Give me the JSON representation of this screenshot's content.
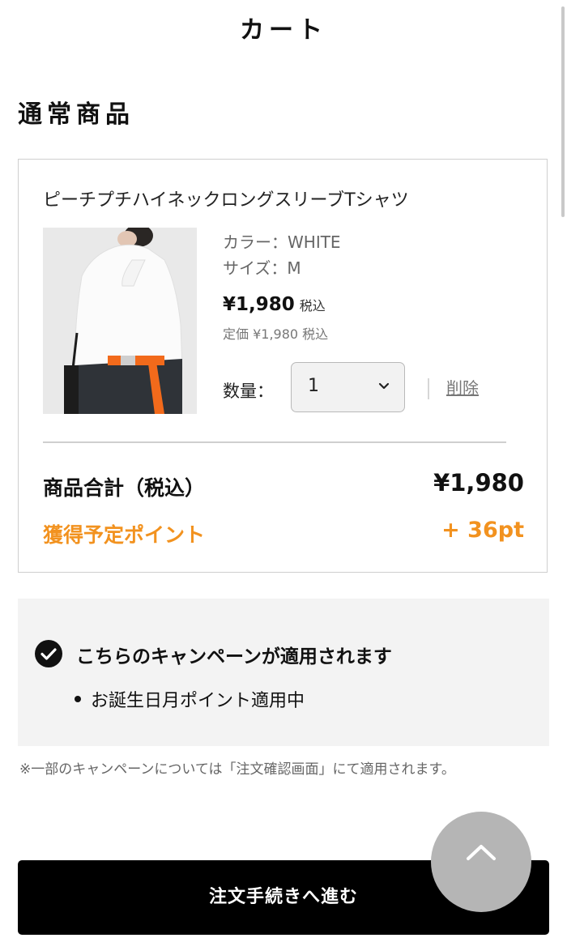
{
  "header": {
    "title": "カート"
  },
  "section": {
    "heading": "通常商品"
  },
  "cart_item": {
    "name": "ピーチプチハイネックロングスリーブTシャツ",
    "image_icon": "product-photo-white-turtleneck",
    "color_line": "カラー：WHITE",
    "size_line": "サイズ：M",
    "price": "¥1,980",
    "price_tax_note": "税込",
    "list_price": "定価 ¥1,980 税込",
    "quantity_label": "数量：",
    "quantity_value": "1",
    "delete_label": "削除"
  },
  "summary": {
    "total_label": "商品合計（税込）",
    "total_value": "¥1,980",
    "points_label": "獲得予定ポイント",
    "points_value": "+ 36pt",
    "points_color": "#f2921f"
  },
  "campaign": {
    "icon": "check-circle-icon",
    "title": "こちらのキャンペーンが適用されます",
    "items": [
      "お誕生日月ポイント適用中"
    ]
  },
  "note": "※一部のキャンペーンについては「注文確認画面」にて適用されます。",
  "checkout": {
    "button_label": "注文手続きへ進む"
  },
  "scroll_top": {
    "icon": "chevron-up-icon"
  }
}
